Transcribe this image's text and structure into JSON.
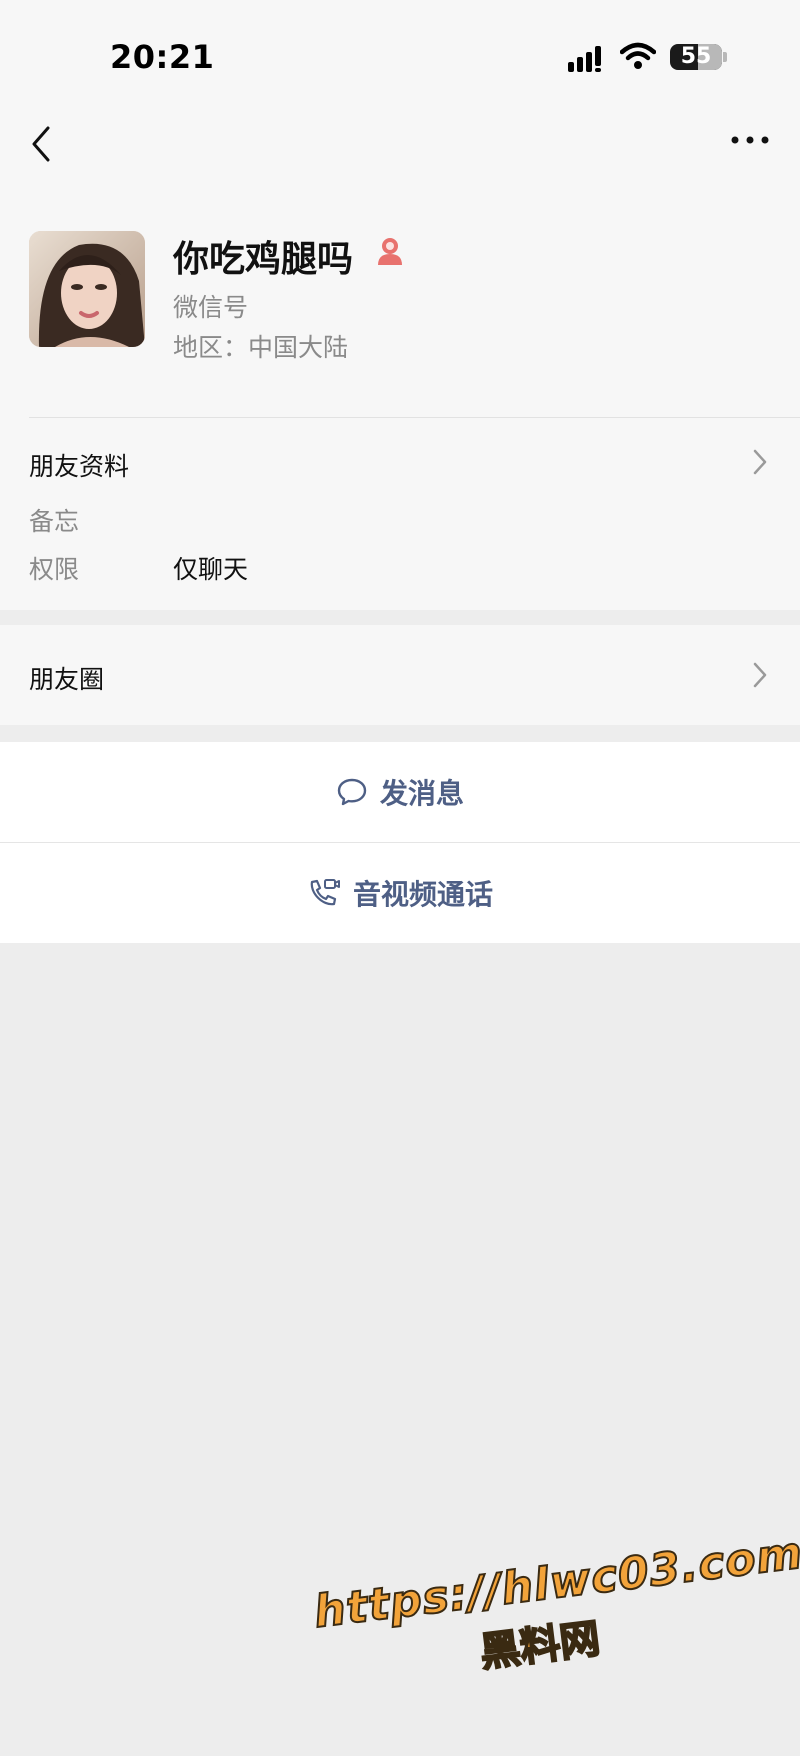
{
  "status_bar": {
    "time": "20:21",
    "battery": "55"
  },
  "profile": {
    "name": "你吃鸡腿吗",
    "wechat_id_label": "微信号",
    "region": "地区：中国大陆",
    "gender_icon": "female-icon",
    "gender_color": "#e8726e"
  },
  "friend_info": {
    "title": "朋友资料",
    "remark_label": "备忘",
    "permission_label": "权限",
    "permission_value": "仅聊天"
  },
  "moments": {
    "title": "朋友圈"
  },
  "actions": {
    "message": "发消息",
    "call": "音视频通话",
    "accent_color": "#4e5f85"
  },
  "watermark": {
    "url": "https://hlwc03.com",
    "text": "黑料网"
  }
}
